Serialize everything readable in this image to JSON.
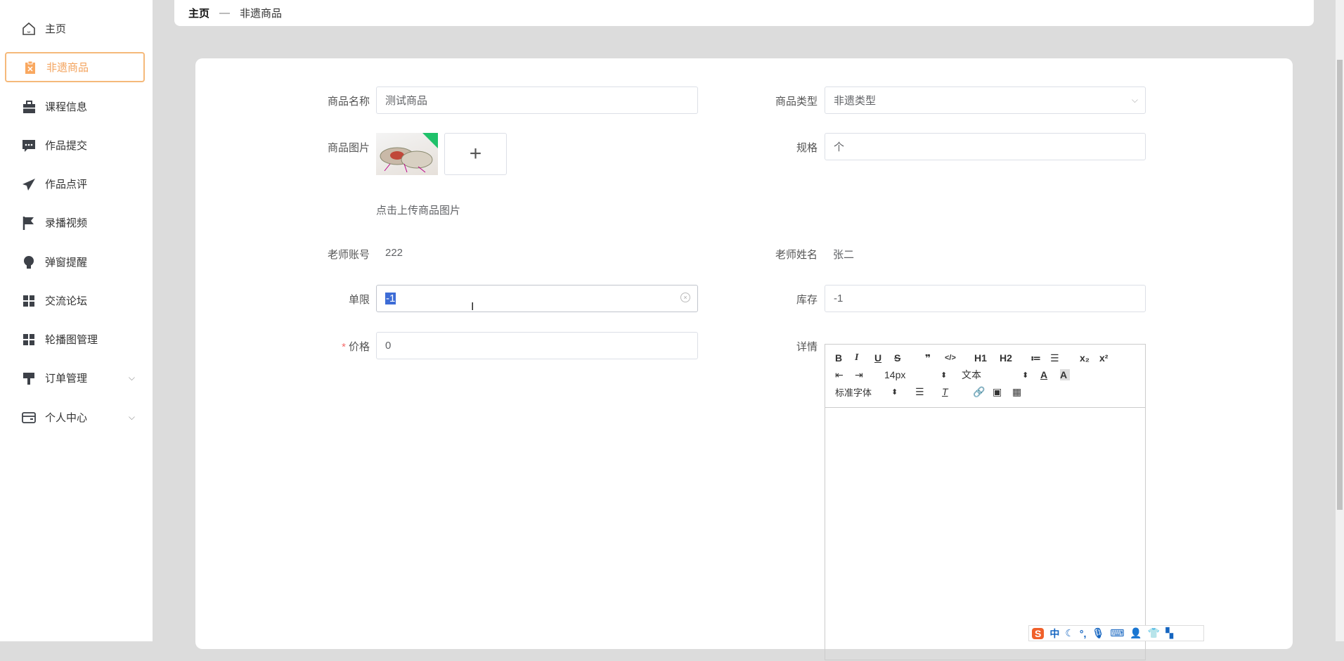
{
  "sidebar": {
    "items": [
      {
        "label": "主页",
        "icon": "home-icon"
      },
      {
        "label": "非遗商品",
        "icon": "clipboard-icon",
        "active": true
      },
      {
        "label": "课程信息",
        "icon": "briefcase-icon"
      },
      {
        "label": "作品提交",
        "icon": "comment-icon"
      },
      {
        "label": "作品点评",
        "icon": "paper-plane-icon"
      },
      {
        "label": "录播视频",
        "icon": "flag-icon"
      },
      {
        "label": "弹窗提醒",
        "icon": "lightbulb-icon"
      },
      {
        "label": "交流论坛",
        "icon": "grid-icon"
      },
      {
        "label": "轮播图管理",
        "icon": "grid-icon"
      },
      {
        "label": "订单管理",
        "icon": "brush-icon",
        "expandable": true
      },
      {
        "label": "个人中心",
        "icon": "card-icon",
        "expandable": true
      }
    ],
    "active_color": "#f3a35d"
  },
  "breadcrumb": {
    "home": "主页",
    "sep": "—",
    "current": "非遗商品"
  },
  "form": {
    "name_label": "商品名称",
    "name_value": "测试商品",
    "type_label": "商品类型",
    "type_value": "非遗类型",
    "image_label": "商品图片",
    "upload_tip": "点击上传商品图片",
    "upload_plus": "+",
    "spec_label": "规格",
    "spec_value": "个",
    "teacher_account_label": "老师账号",
    "teacher_account_value": "222",
    "teacher_name_label": "老师姓名",
    "teacher_name_value": "张二",
    "limit_label": "单限",
    "limit_value": "-1",
    "stock_label": "库存",
    "stock_value": "-1",
    "price_required": "*",
    "price_label": "价格",
    "price_value": "0",
    "detail_label": "详情"
  },
  "editor": {
    "row1": [
      "B",
      "I",
      "U",
      "S",
      "❞",
      "</>",
      "H1",
      "H2",
      "≔",
      "☰",
      "x₂",
      "x²"
    ],
    "font_size": "14px",
    "heading": "文本",
    "font_family": "标准字体",
    "updown": "⬍"
  },
  "ime": {
    "label": "中"
  }
}
